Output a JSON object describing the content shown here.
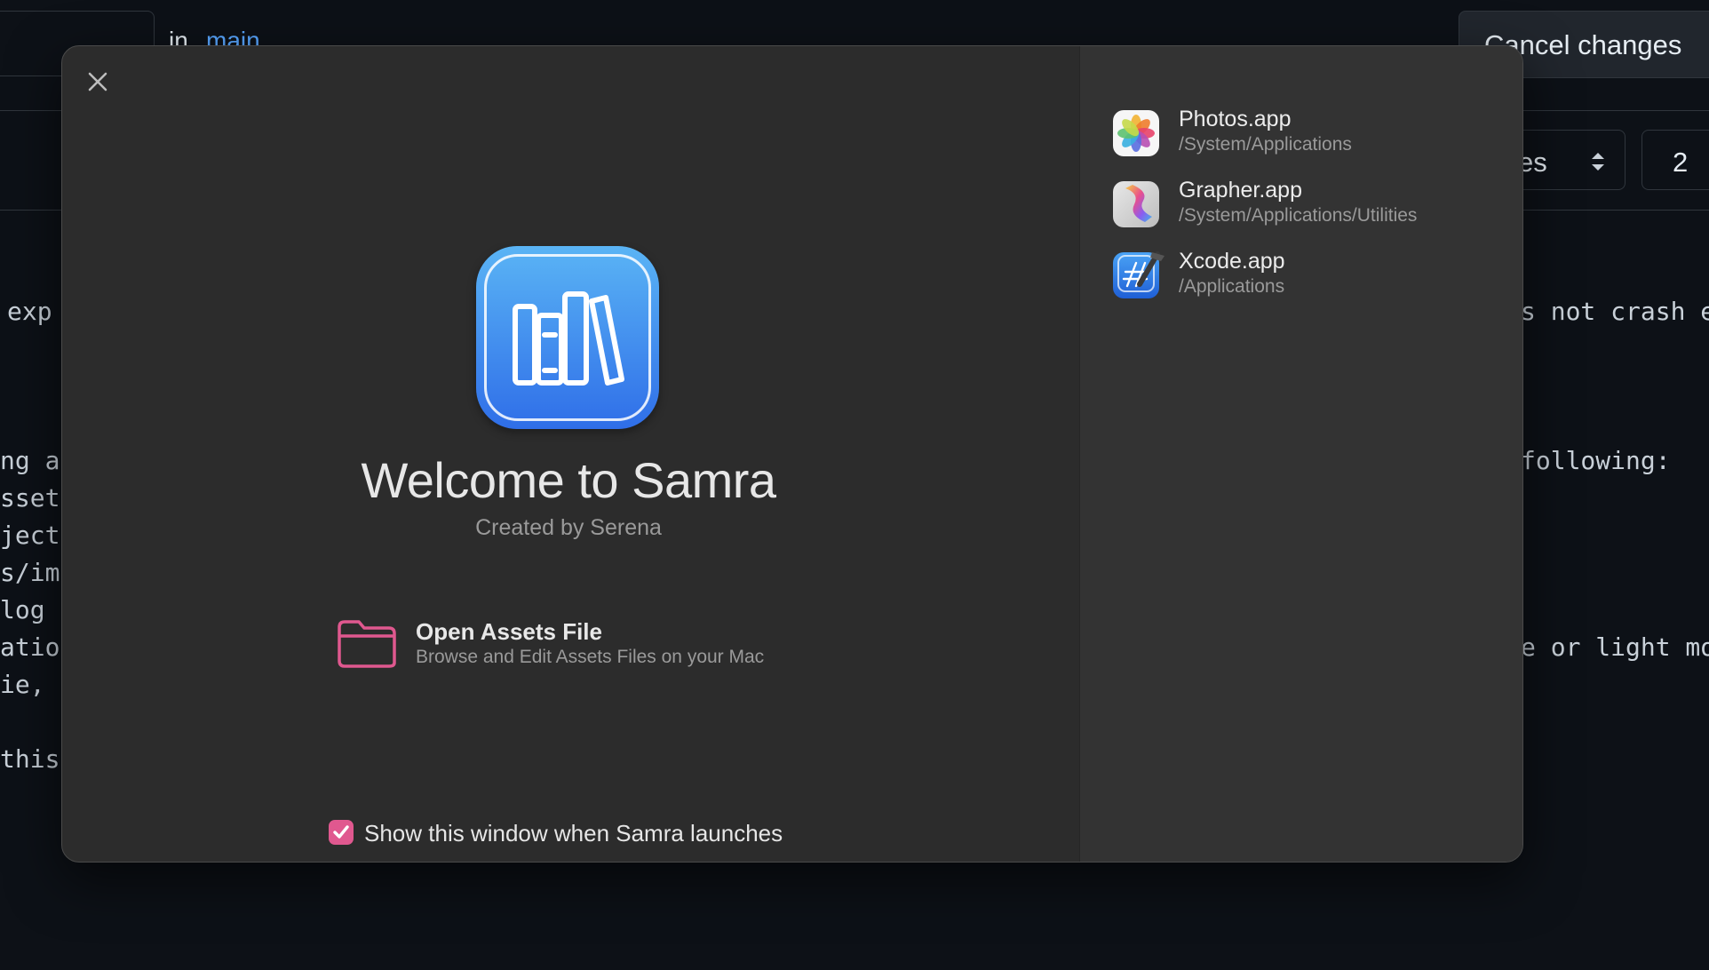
{
  "background": {
    "branch_prefix": "in",
    "branch_name": "main",
    "cancel_button": "Cancel changes",
    "select_partial": "es",
    "number_field": "2",
    "code_left": [
      "exp",
      "ng as",
      "sset ",
      "jects",
      "s/ima",
      "log t",
      "ation",
      "ie, F",
      "this "
    ],
    "code_right": [
      "s not crash e",
      "following:",
      "e or light mo"
    ]
  },
  "welcome": {
    "title": "Welcome to Samra",
    "subtitle": "Created by Serena",
    "open_title": "Open Assets File",
    "open_description": "Browse and Edit Assets Files on your Mac",
    "show_on_launch_label": "Show this window when Samra launches",
    "show_on_launch_checked": true
  },
  "recent_apps": [
    {
      "name": "Photos.app",
      "path": "/System/Applications",
      "icon": "photos-icon"
    },
    {
      "name": "Grapher.app",
      "path": "/System/Applications/Utilities",
      "icon": "grapher-icon"
    },
    {
      "name": "Xcode.app",
      "path": "/Applications",
      "icon": "xcode-icon"
    }
  ],
  "colors": {
    "accent_pink": "#e0588f",
    "app_icon_top": "#5ab4f5",
    "app_icon_bottom": "#2f6ee8",
    "link_blue": "#58a6ff"
  }
}
